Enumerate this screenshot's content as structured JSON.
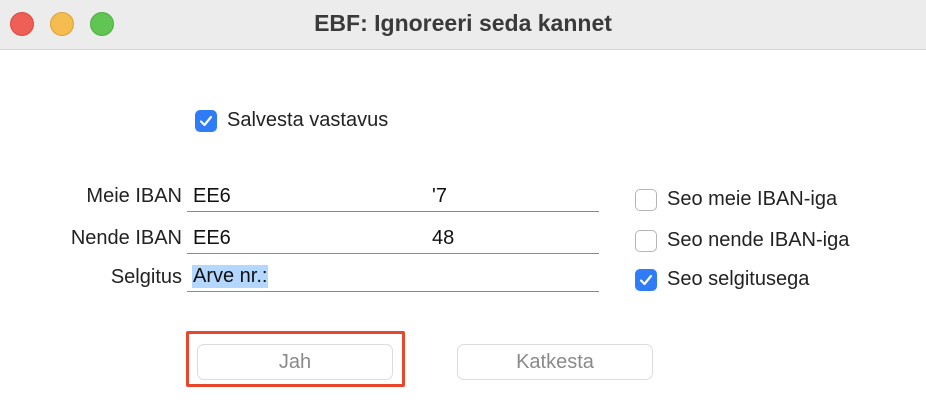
{
  "window": {
    "title": "EBF: Ignoreeri seda kannet"
  },
  "save_mapping": {
    "label": "Salvesta vastavus",
    "checked": true
  },
  "rows": [
    {
      "label": "Meie IBAN",
      "value": "EE6",
      "tail": "'7",
      "link_label": "Seo meie IBAN-iga",
      "link_checked": false
    },
    {
      "label": "Nende IBAN",
      "value": "EE6",
      "tail": "48",
      "link_label": "Seo nende IBAN-iga",
      "link_checked": false
    },
    {
      "label": "Selgitus",
      "value": "Arve nr.:",
      "tail": "",
      "link_label": "Seo selgitusega",
      "link_checked": true
    }
  ],
  "buttons": {
    "ok_label": "Jah",
    "cancel_label": "Katkesta"
  },
  "colors": {
    "accent": "#2f7cf6",
    "highlight": "#e8472c",
    "selection": "#b4d7ff"
  }
}
